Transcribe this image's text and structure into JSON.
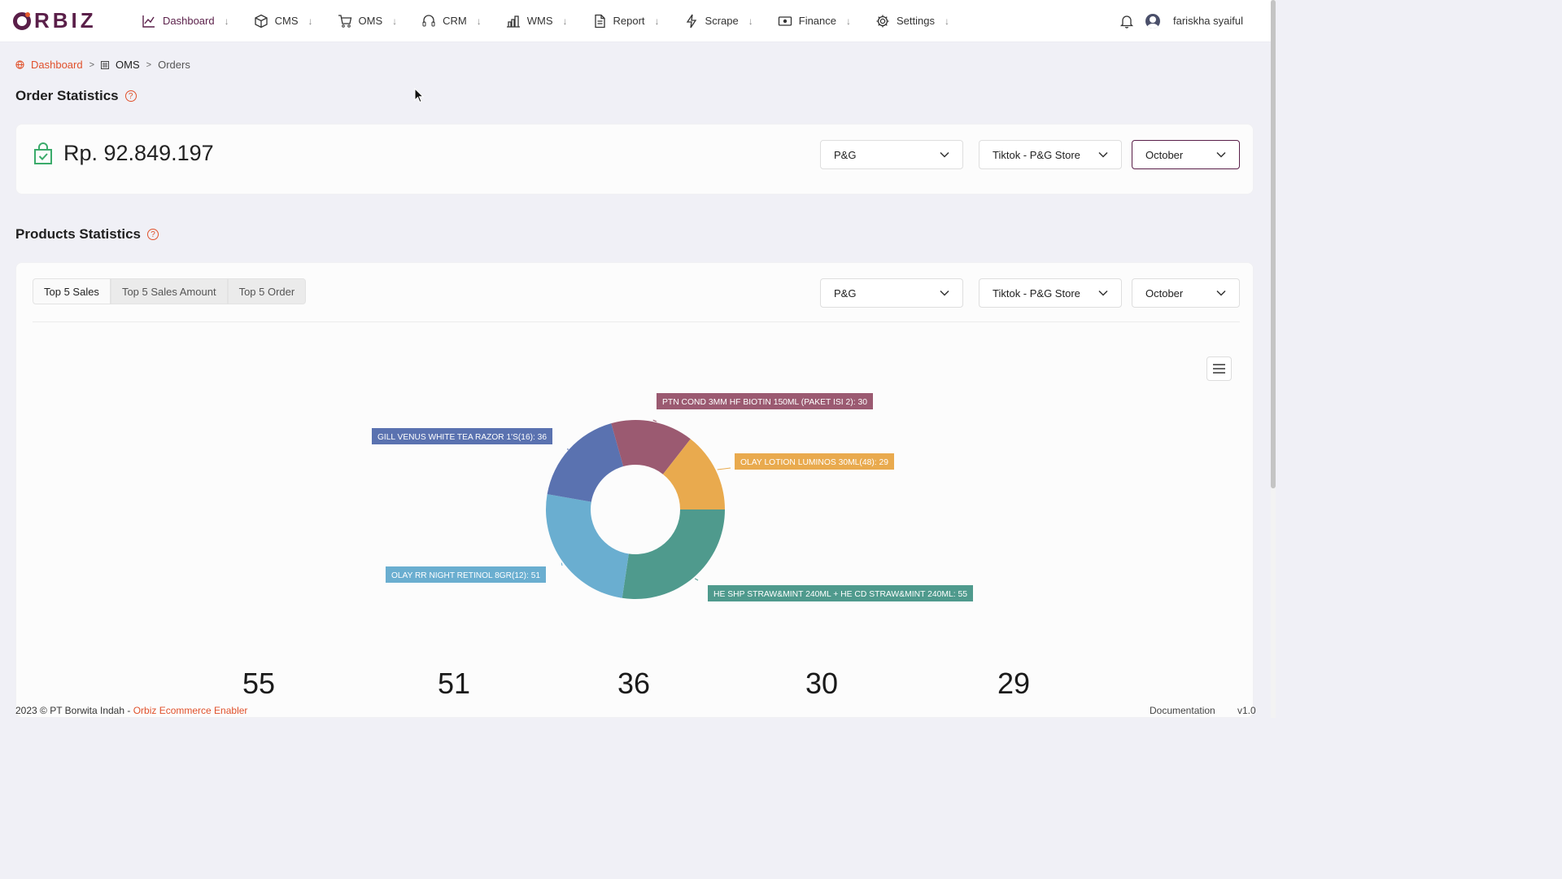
{
  "nav": {
    "logo": "RBIZ",
    "items": [
      {
        "label": "Dashboard",
        "icon": "chart-line-icon"
      },
      {
        "label": "CMS",
        "icon": "box-icon"
      },
      {
        "label": "OMS",
        "icon": "cart-icon"
      },
      {
        "label": "CRM",
        "icon": "headset-icon"
      },
      {
        "label": "WMS",
        "icon": "warehouse-icon"
      },
      {
        "label": "Report",
        "icon": "document-icon"
      },
      {
        "label": "Scrape",
        "icon": "bolt-icon"
      },
      {
        "label": "Finance",
        "icon": "cash-icon"
      },
      {
        "label": "Settings",
        "icon": "gear-icon"
      }
    ],
    "arrow": "↓",
    "username": "fariskha syaiful"
  },
  "breadcrumb": {
    "dashboard": "Dashboard",
    "sep": ">",
    "oms": "OMS",
    "orders": "Orders"
  },
  "order_stats": {
    "title": "Order Statistics",
    "help": "?",
    "amount": "Rp. 92.849.197",
    "filters": {
      "brand": "P&G",
      "store": "Tiktok - P&G Store",
      "month": "October"
    }
  },
  "product_stats": {
    "title": "Products Statistics",
    "help": "?",
    "tabs": [
      "Top 5 Sales",
      "Top 5 Sales Amount",
      "Top 5 Order"
    ],
    "filters": {
      "brand": "P&G",
      "store": "Tiktok - P&G Store",
      "month": "October"
    }
  },
  "chart_data": {
    "type": "pie",
    "donut": true,
    "slices": [
      {
        "label": "HE SHP STRAW&MINT 240ML + HE CD STRAW&MINT 240ML",
        "value": 55,
        "color": "#4f9a8d"
      },
      {
        "label": "OLAY RR NIGHT RETINOL 8GR(12)",
        "value": 51,
        "color": "#6aaed0"
      },
      {
        "label": "GILL VENUS WHITE TEA RAZOR 1'S(16)",
        "value": 36,
        "color": "#5a72b0"
      },
      {
        "label": "PTN COND 3MM HF BIOTIN 150ML (PAKET ISI 2)",
        "value": 30,
        "color": "#9b5a71"
      },
      {
        "label": "OLAY LOTION LUMINOS 30ML(48)",
        "value": 29,
        "color": "#e9aa4e"
      }
    ],
    "data_labels": [
      "HE SHP STRAW&MINT 240ML + HE CD STRAW&MINT 240ML: 55",
      "OLAY RR NIGHT RETINOL 8GR(12): 51",
      "GILL VENUS WHITE TEA RAZOR 1'S(16): 36",
      "PTN COND 3MM HF BIOTIN 150ML (PAKET ISI 2): 30",
      "OLAY LOTION LUMINOS 30ML(48): 29"
    ]
  },
  "stat_numbers": [
    "55",
    "51",
    "36",
    "30",
    "29"
  ],
  "footer": {
    "copyright": "2023 © PT Borwita Indah - ",
    "brand": "Orbiz Ecommerce Enabler",
    "documentation": "Documentation",
    "version": "v1.0"
  }
}
